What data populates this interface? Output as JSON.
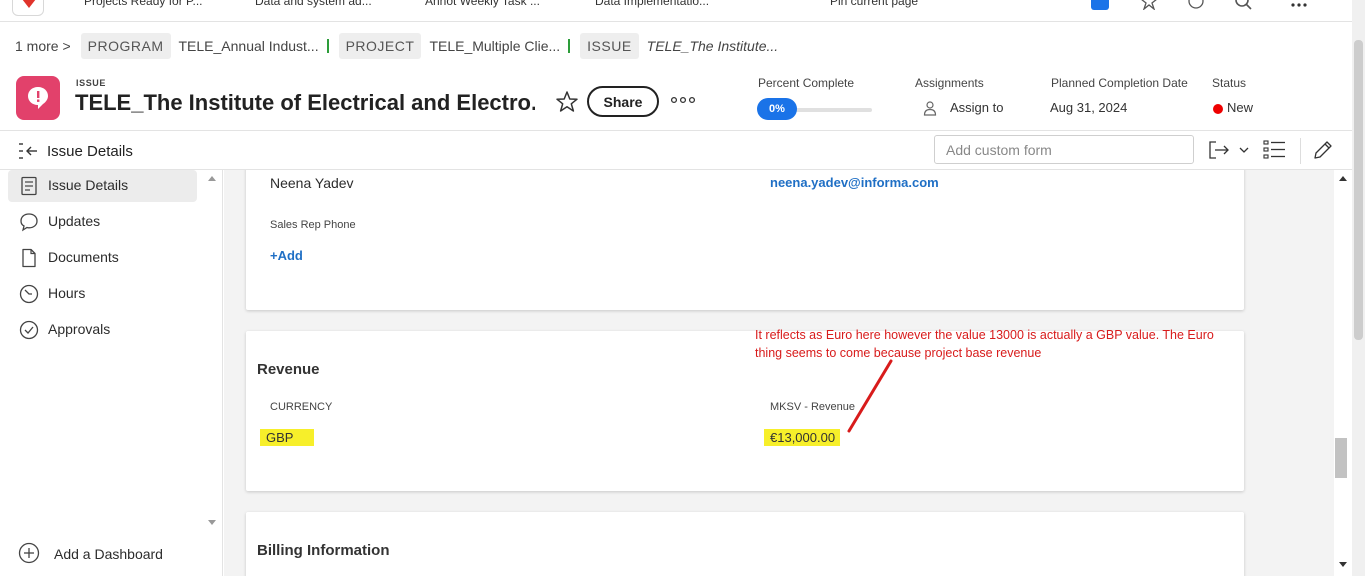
{
  "topbar": {
    "tabs": [
      "Projects Ready for P...",
      "Data and system ad...",
      "Annot Weekly Task ...",
      "Data Implementatio...",
      "Pin current page"
    ]
  },
  "breadcrumb": {
    "more": "1 more",
    "items": [
      {
        "tag": "PROGRAM",
        "value": "TELE_Annual Indust..."
      },
      {
        "tag": "PROJECT",
        "value": "TELE_Multiple Clie..."
      },
      {
        "tag": "ISSUE",
        "value": "TELE_The Institute..."
      }
    ]
  },
  "header": {
    "type": "ISSUE",
    "title": "TELE_The Institute of Electrical and Electro...",
    "share_label": "Share",
    "percent_complete_label": "Percent Complete",
    "percent_complete_value": "0%",
    "percent_complete": 0,
    "assignments_label": "Assignments",
    "assign_to": "Assign to",
    "planned_completion_label": "Planned Completion Date",
    "planned_completion_value": "Aug 31, 2024",
    "status_label": "Status",
    "status_value": "New",
    "status_color": "#e00000"
  },
  "toolbar": {
    "title": "Issue Details",
    "custom_form_placeholder": "Add custom form"
  },
  "nav": {
    "items": [
      {
        "label": "Issue Details",
        "icon": "document-icon",
        "active": true
      },
      {
        "label": "Updates",
        "icon": "chat-bubble-icon",
        "active": false
      },
      {
        "label": "Documents",
        "icon": "file-icon",
        "active": false
      },
      {
        "label": "Hours",
        "icon": "clock-icon",
        "active": false
      },
      {
        "label": "Approvals",
        "icon": "check-circle-icon",
        "active": false
      }
    ],
    "add_dashboard": "Add a Dashboard"
  },
  "contact_card": {
    "name": "Neena Yadev",
    "email": "neena.yadev@informa.com",
    "sales_rep_phone_label": "Sales Rep Phone",
    "add_label": "+Add"
  },
  "revenue_card": {
    "title": "Revenue",
    "currency_label": "CURRENCY",
    "currency_value": "GBP",
    "mksv_label": "MKSV - Revenue",
    "mksv_value": "€13,000.00",
    "highlight_color": "#f7ef2a"
  },
  "billing_card": {
    "title": "Billing Information"
  },
  "annotation": {
    "text": "It reflects as Euro here however the value 13000 is actually a GBP value. The Euro thing seems to come because project base revenue",
    "color": "#d81b1b"
  },
  "colors": {
    "accent": "#1a73e8",
    "issue_badge": "#e2416b",
    "link": "#1f6fc5",
    "crumb_separator": "#2d9d3a"
  }
}
